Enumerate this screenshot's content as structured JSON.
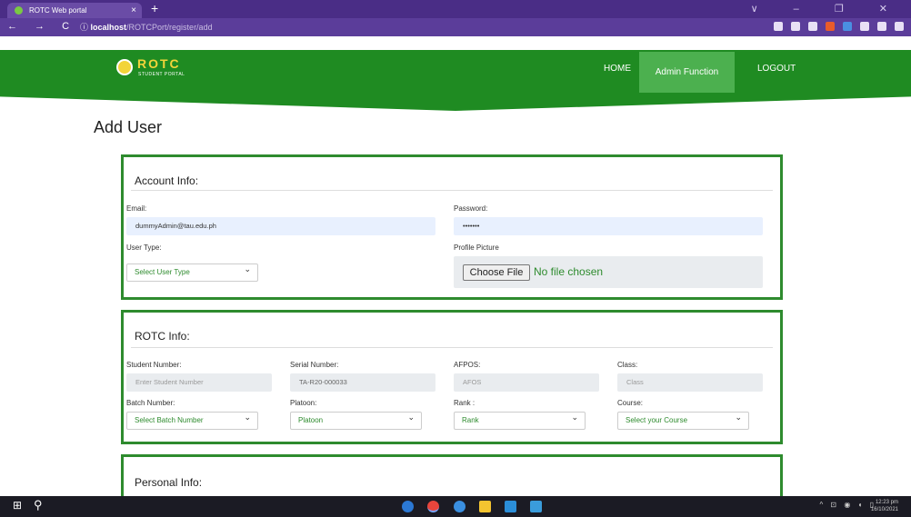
{
  "browser": {
    "tab_title": "ROTC Web portal",
    "tab_close": "×",
    "new_tab": "+",
    "window_controls": "∨ – ❐ ✕",
    "nav_glyphs": "← → C",
    "url_prefix": "ⓘ",
    "url_host": "localhost",
    "url_path": "/ROTCPort/register/add"
  },
  "site": {
    "logo_title": "ROTC",
    "logo_subtitle": "STUDENT PORTAL",
    "menu": {
      "home": "HOME",
      "admin": "Admin Function",
      "logout": "LOGOUT"
    }
  },
  "page": {
    "title": "Add User"
  },
  "account": {
    "heading": "Account Info:",
    "email_label": "Email:",
    "email_value": "dummyAdmin@tau.edu.ph",
    "password_label": "Password:",
    "password_value": "•••••••",
    "usertype_label": "User Type:",
    "usertype_value": "Select User Type",
    "picture_label": "Profile Picture",
    "choose_file": "Choose File",
    "no_file": "No file chosen"
  },
  "rotc": {
    "heading": "ROTC Info:",
    "student_label": "Student Number:",
    "student_placeholder": "Enter Student Number",
    "serial_label": "Serial Number:",
    "serial_value": "TA-R20-000033",
    "afpos_label": "AFPOS:",
    "afpos_value": "AFOS",
    "class_label": "Class:",
    "class_value": "Class",
    "batch_label": "Batch Number:",
    "batch_value": "Select Batch Number",
    "platoon_label": "Platoon:",
    "platoon_value": "Platoon",
    "rank_label": "Rank :",
    "rank_value": "Rank",
    "course_label": "Course:",
    "course_value": "Select your Course"
  },
  "personal": {
    "heading": "Personal Info:"
  },
  "taskbar": {
    "start": "⊞",
    "search": "⚲",
    "tray": "^ ⊡ ◉ ◖ ▯",
    "time": "12:23 pm",
    "date": "16/10/2021"
  },
  "colors": {
    "primary": "#1f8b22",
    "active_menu": "#4cb04f",
    "browser": "#4a2d86"
  }
}
